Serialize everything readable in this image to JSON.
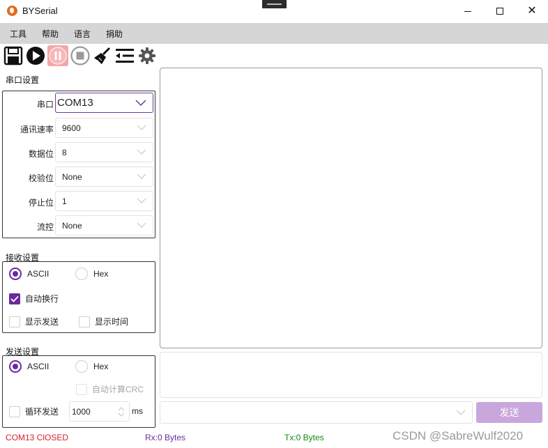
{
  "window": {
    "title": "BYSerial",
    "min_icon": "minimize-icon",
    "max_icon": "maximize-icon",
    "close_glyph": "✕"
  },
  "menu": {
    "items": [
      "工具",
      "帮助",
      "语言",
      "捐助"
    ]
  },
  "toolbar": {
    "icons": [
      "save-icon",
      "play-icon",
      "pause-icon",
      "stop-icon",
      "clear-broom-icon",
      "list-indent-icon",
      "gear-icon"
    ]
  },
  "serial_settings": {
    "title": "串口设置",
    "port": {
      "label": "串口",
      "value": "COM13"
    },
    "baud": {
      "label": "通讯速率",
      "value": "9600"
    },
    "data_bits": {
      "label": "数据位",
      "value": "8"
    },
    "parity": {
      "label": "校验位",
      "value": "None"
    },
    "stop_bits": {
      "label": "停止位",
      "value": "1"
    },
    "flow": {
      "label": "流控",
      "value": "None"
    }
  },
  "receive_settings": {
    "title": "接收设置",
    "ascii_label": "ASCII",
    "hex_label": "Hex",
    "selected": "ASCII",
    "auto_newline_label": "自动换行",
    "auto_newline_checked": true,
    "show_send_label": "显示发送",
    "show_send_checked": false,
    "show_time_label": "显示时间",
    "show_time_checked": false
  },
  "send_settings": {
    "title": "发送设置",
    "ascii_label": "ASCII",
    "hex_label": "Hex",
    "selected": "ASCII",
    "crc_label": "自动计算CRC",
    "crc_checked": false,
    "loop_label": "循环发送",
    "loop_checked": false,
    "interval_value": "1000",
    "interval_unit": "ms"
  },
  "send": {
    "button_label": "发送"
  },
  "status": {
    "port_status": "COM13 ClOSED",
    "rx": "Rx:0 Bytes",
    "tx": "Tx:0 Bytes",
    "watermark": "CSDN @SabreWulf2020"
  },
  "colors": {
    "accent": "#6a2a9c",
    "closed_red": "#d2232a",
    "tx_green": "#128a12",
    "send_button": "#c9a7dd",
    "menubar": "#d6d6d6"
  }
}
